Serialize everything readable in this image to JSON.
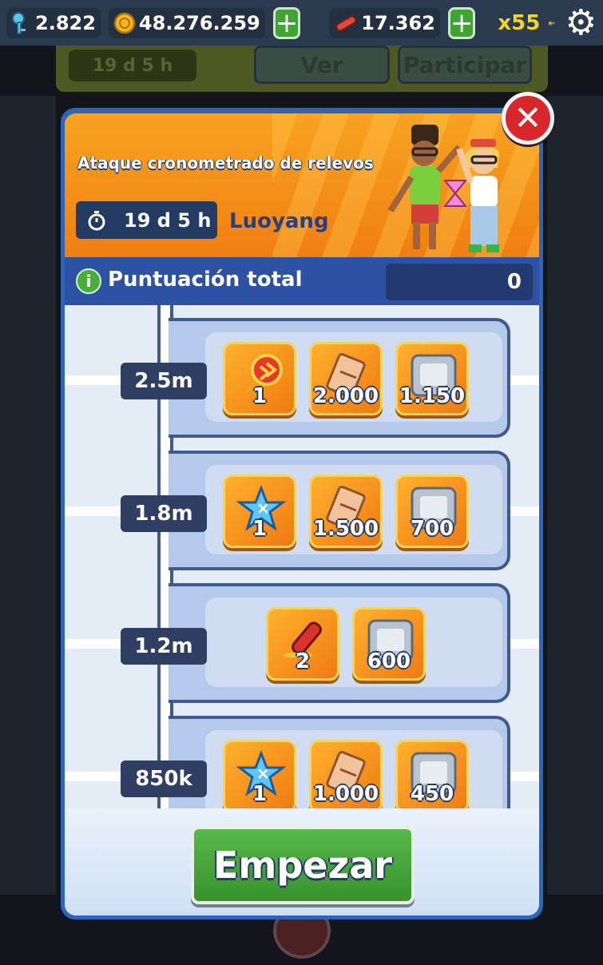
{
  "topbar": {
    "keys": "2.822",
    "coins": "48.276.259",
    "hoverboards": "17.362",
    "multiplier": "x55",
    "icons": [
      "key-icon",
      "coin-icon",
      "hoverboard-icon",
      "star-icon",
      "gear-icon"
    ]
  },
  "background": {
    "timer": "19 d 5 h",
    "view_label": "Ver",
    "join_label": "Participar"
  },
  "event": {
    "title": "Ataque cronometrado de relevos",
    "timer": "19 d 5 h",
    "city": "Luoyang"
  },
  "score": {
    "label": "Puntuación total",
    "value": "0"
  },
  "tiers": [
    {
      "threshold": "2.5m",
      "rewards": [
        {
          "icon": "rocket-icon",
          "qty": "1"
        },
        {
          "icon": "ticket-icon",
          "qty": "2.000"
        },
        {
          "icon": "silver-token-icon",
          "qty": "1.150"
        }
      ]
    },
    {
      "threshold": "1.8m",
      "rewards": [
        {
          "icon": "star-booster-icon",
          "qty": "1"
        },
        {
          "icon": "ticket-icon",
          "qty": "1.500"
        },
        {
          "icon": "silver-token-icon",
          "qty": "700"
        }
      ]
    },
    {
      "threshold": "1.2m",
      "rewards": [
        {
          "icon": "hoverboard-icon",
          "qty": "2"
        },
        {
          "icon": "silver-token-icon",
          "qty": "600"
        }
      ]
    },
    {
      "threshold": "850k",
      "rewards": [
        {
          "icon": "star-booster-icon",
          "qty": "1"
        },
        {
          "icon": "ticket-icon",
          "qty": "1.000"
        },
        {
          "icon": "silver-token-icon",
          "qty": "450"
        }
      ]
    }
  ],
  "start_label": "Empezar",
  "colors": {
    "banner": "#f28a17",
    "popup_border": "#2f64b9",
    "start_button": "#43a537",
    "close_button": "#d8262a"
  }
}
